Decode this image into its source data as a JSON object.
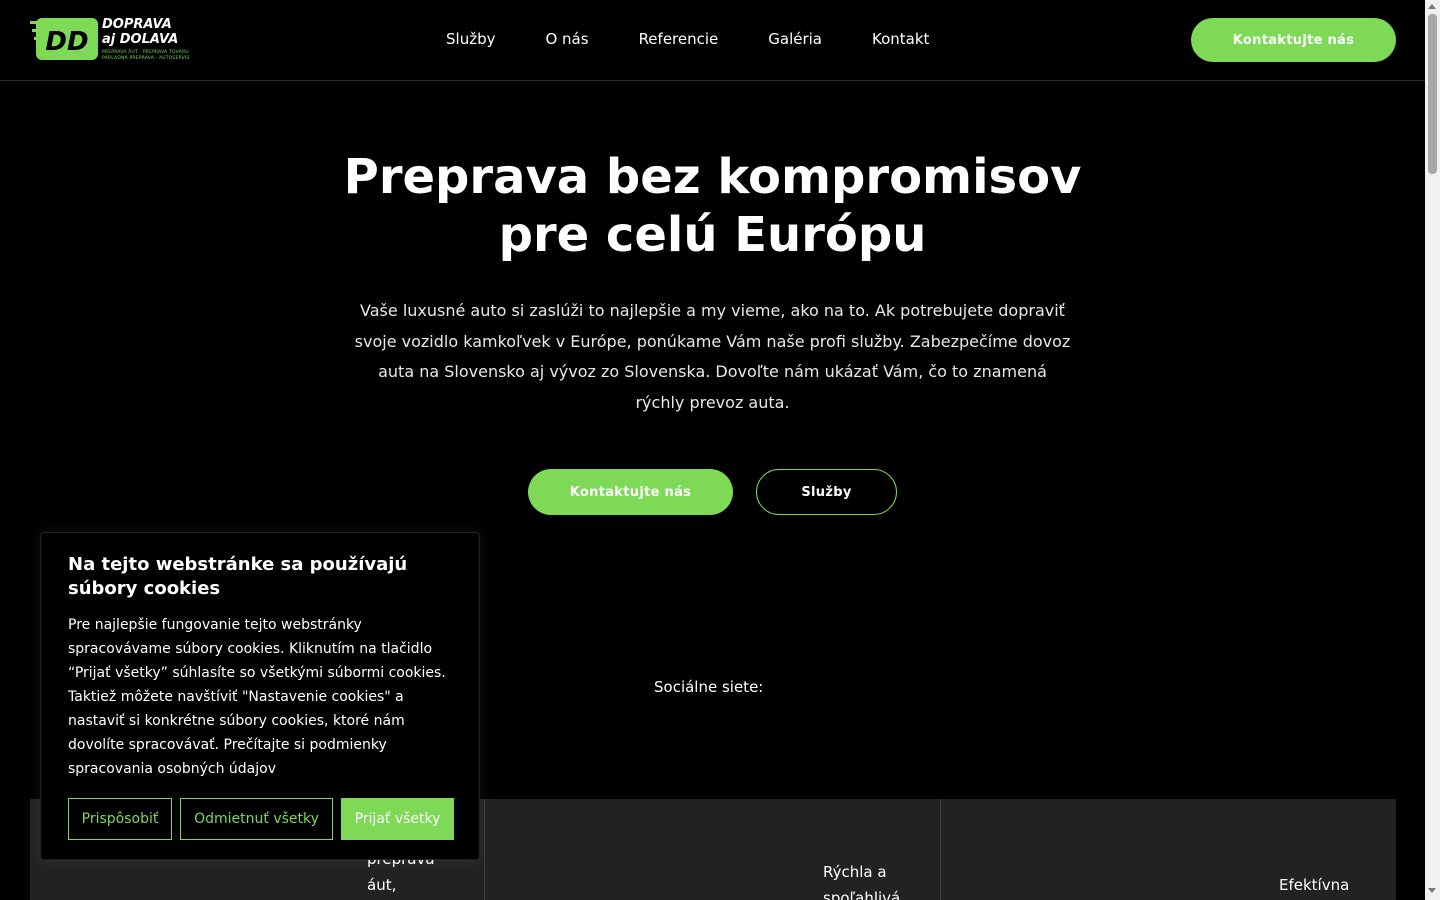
{
  "brand": {
    "logo_letters": "DD",
    "name_line1": "DOPRAVA",
    "name_line2": "aj DOLAVA",
    "tagline_line1": "PREPRAVA ÁUT · PREPRAVA TOVARU",
    "tagline_line2": "PÁRLADNÁ PREPRAVA · AUTOSERVIS",
    "accent_color": "#7ed957"
  },
  "nav": {
    "items": [
      "Služby",
      "O nás",
      "Referencie",
      "Galéria",
      "Kontakt"
    ],
    "cta_label": "Kontaktujte nás"
  },
  "hero": {
    "title_line1": "Preprava bez kompromisov",
    "title_line2": "pre celú Európu",
    "text": "Vaše luxusné auto si zaslúži to najlepšie a my vieme, ako na to. Ak potrebujete dopraviť svoje vozidlo kamkoľvek v Európe, ponúkame Vám naše profi služby. Zabezpečíme dovoz auta na Slovensko aj vývoz zo Slovenska. Dovoľte nám ukázať Vám, čo to znamená rýchly prevoz auta.",
    "primary_button": "Kontaktujte nás",
    "secondary_button": "Služby"
  },
  "social": {
    "label": "Sociálne siete:"
  },
  "cards": {
    "card1_text": "preprava áut,",
    "card2_text": "Rýchla a spoľahlivá",
    "card3_text": "Efektívna"
  },
  "cookie": {
    "title": "Na tejto webstránke sa používajú súbory cookies",
    "text": "Pre najlepšie fungovanie tejto webstránky spracovávame súbory cookies. Kliknutím na tlačidlo “Prijať všetky” súhlasíte so všetkými súbormi cookies. Taktiež môžete navštíviť \"Nastavenie cookies\" a nastaviť si konkrétne súbory cookies, ktoré nám dovolíte spracovávať. Prečítajte si podmienky spracovania osobných údajov",
    "customize_button": "Prispôsobiť",
    "reject_button": "Odmietnuť všetky",
    "accept_button": "Prijať všetky"
  }
}
